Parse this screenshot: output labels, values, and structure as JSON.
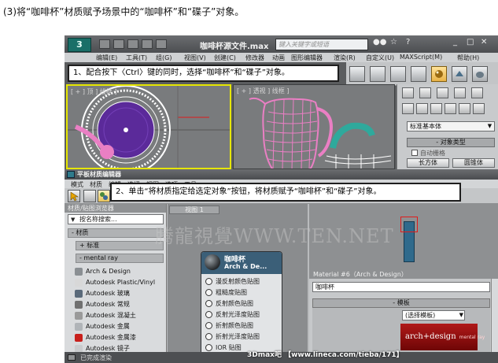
{
  "step_title": "(3)将“咖啡杯”材质赋予场景中的“咖啡杯”和“碟子”对象。",
  "max_window": {
    "logo_label": "3",
    "filename": "咖啡杯源文件.max",
    "search_placeholder": "键入关键字或短语",
    "title_icons": [
      "binoculars-icon",
      "star-icon",
      "help-icon"
    ],
    "menu": [
      "编辑(E)",
      "工具(T)",
      "组(G)",
      "视图(V)",
      "创建(C)",
      "修改器",
      "动画",
      "图形编辑器",
      "渲染(R)",
      "自定义(U)",
      "MAXScript(M)",
      "帮助(H)"
    ],
    "viewport_top_label": "[ + ] 顶 ] 线框 ]",
    "viewport_front_label": "[ + ] 透视 ] 线框 ]",
    "command_panel": {
      "dropdown": "标准基本体",
      "rollout": "- 对象类型",
      "autogrid": "自动栅格",
      "buttons": [
        "长方体",
        "圆锥体"
      ]
    }
  },
  "callouts": {
    "step1": "1、配合按下〈Ctrl〉键的同时，选择“咖啡杯”和“碟子”对象。",
    "step2": "2、单击“将材质指定给选定对象”按钮，将材质赋予“咖啡杯”和“碟子”对象。"
  },
  "slate": {
    "title": "平板材质编辑器",
    "menu": [
      "模式",
      "材质",
      "编辑",
      "选择",
      "视图",
      "选项",
      "工具"
    ],
    "browser": {
      "header": "材质/贴图浏览器",
      "search": "按名称搜索...",
      "groups": [
        "- 材质",
        "+ 标准",
        "- mental ray"
      ],
      "items": [
        {
          "label": "Arch & Design",
          "color": "#8a8f93"
        },
        {
          "label": "Autodesk Plastic/Vinyl",
          "color": "#d8d8d8"
        },
        {
          "label": "Autodesk 玻璃",
          "color": "#5a6a7a"
        },
        {
          "label": "Autodesk 常规",
          "color": "#707070"
        },
        {
          "label": "Autodesk 混凝土",
          "color": "#9a9a9a"
        },
        {
          "label": "Autodesk 金属",
          "color": "#b0b4b8"
        },
        {
          "label": "Autodesk 金属漆",
          "color": "#c8201c"
        },
        {
          "label": "Autodesk 镜子",
          "color": "#c9cbcd"
        }
      ]
    },
    "view_tab": "视图 1",
    "node": {
      "name": "咖啡杯",
      "type": "Arch & De...",
      "slots": [
        "漫反射颜色贴图",
        "粗糙度贴图",
        "反射颜色贴图",
        "反射光泽度贴图",
        "折射颜色贴图",
        "折射光泽度贴图",
        "IOR 贴图"
      ]
    },
    "params": {
      "header": "Material #6（Arch & Design）",
      "name_value": "咖啡杯",
      "rollout": "- 模板",
      "template": "(选择模板)",
      "logo": "arch+design",
      "logo_sub": "mental ray"
    },
    "status": "已完成渲染"
  },
  "watermarks": {
    "main": "腾龍視覺WWW.TEN.NET",
    "credit": "3Dmax吧 【www.lineca.com/tieba/171】"
  },
  "colors": {
    "cup_wire": "#ea7fc4",
    "selection_wire": "#ffffff",
    "plate_blue": "#5b2a9a",
    "accent_red": "#e01b1b",
    "teal": "#2fa99c"
  }
}
